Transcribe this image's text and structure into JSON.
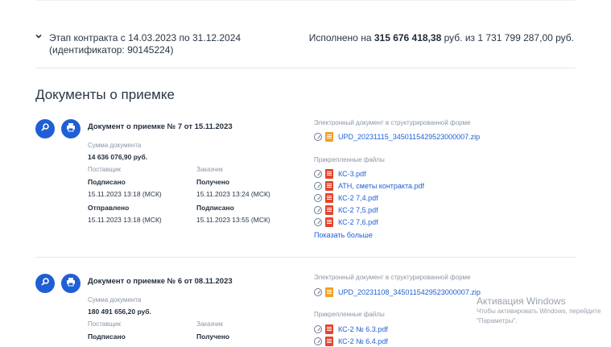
{
  "stage": {
    "line1": "Этап контракта с 14.03.2023 по 31.12.2024",
    "line2": "(идентификатор: 90145224)",
    "done_prefix": "Исполнено на",
    "done_amount": "315 676 418,38",
    "done_suffix": "руб. из 1 731 799 287,00 руб."
  },
  "section_title": "Документы о приемке",
  "documents": [
    {
      "title": "Документ о приемке № 7 от 15.11.2023",
      "sum_label": "Сумма документа",
      "sum_value": "14 636 076,90 руб.",
      "supplier_label": "Поставщик",
      "customer_label": "Заказчик",
      "supplier_status1": "Подписано",
      "supplier_date1": "15.11.2023 13:18 (МСК)",
      "supplier_status2": "Отправлено",
      "supplier_date2": "15.11.2023 13:18 (МСК)",
      "customer_status1": "Получено",
      "customer_date1": "15.11.2023 13:24 (МСК)",
      "customer_status2": "Подписано",
      "customer_date2": "15.11.2023 13:55 (МСК)",
      "edoc_label": "Электронный документ в структурированной форме",
      "edoc_file": "UPD_20231115_3450115429523000007.zip",
      "attach_label": "Прикрепленные файлы",
      "files": [
        "КС-3.pdf",
        "АТН, сметы контракта.pdf",
        "КС-2 7,4.pdf",
        "КС-2 7,5.pdf",
        "КС-2 7,6.pdf"
      ],
      "more_label": "Показать больше"
    },
    {
      "title": "Документ о приемке № 6 от 08.11.2023",
      "sum_label": "Сумма документа",
      "sum_value": "180 491 656,20 руб.",
      "supplier_label": "Поставщик",
      "customer_label": "Заказчик",
      "supplier_status1": "Подписано",
      "customer_status1": "Получено",
      "edoc_label": "Электронный документ в структурированной форме",
      "edoc_file": "UPD_20231108_3450115429523000007.zip",
      "attach_label": "Прикрепленные файлы",
      "files": [
        "КС-2 № 6.3.pdf",
        "КС-2 № 6.4.pdf"
      ]
    }
  ],
  "watermark": {
    "title": "Активация Windows",
    "line1": "Чтобы активировать Windows, перейдите",
    "line2": "\"Параметры\"."
  },
  "colors": {
    "accent": "#1f5fd6",
    "pdf": "#e2462f",
    "zip": "#f2a12a"
  }
}
